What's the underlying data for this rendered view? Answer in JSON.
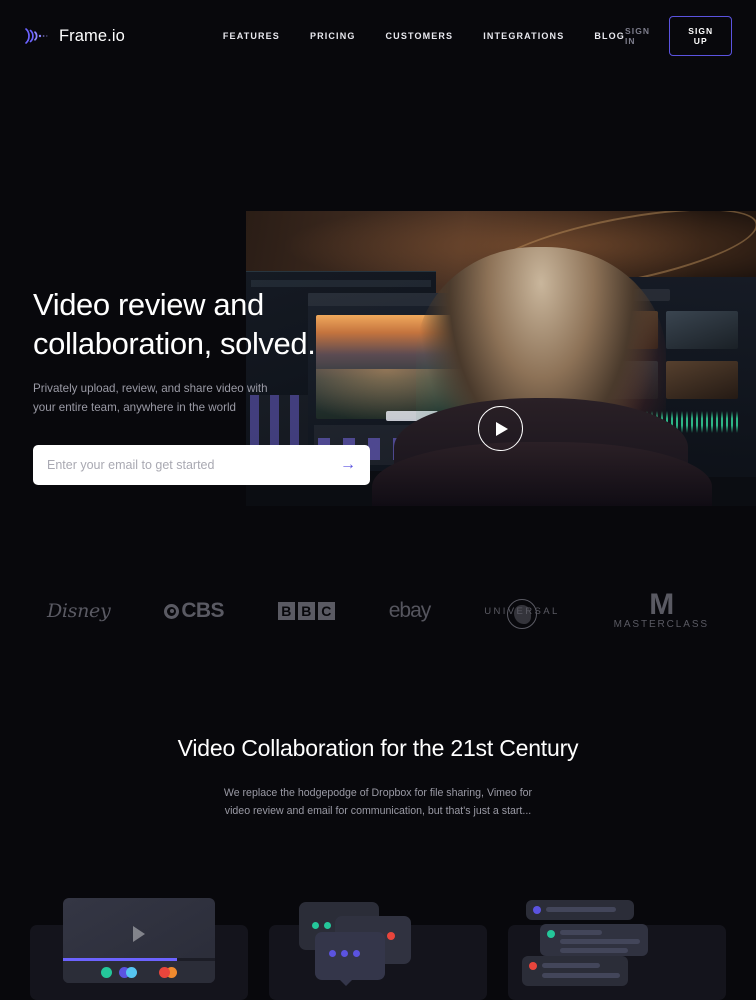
{
  "brand": {
    "name": "Frame.io",
    "logo_icon": "waveform-icon",
    "accent": "#5b53e0"
  },
  "nav": {
    "links": [
      {
        "label": "FEATURES"
      },
      {
        "label": "PRICING"
      },
      {
        "label": "CUSTOMERS"
      },
      {
        "label": "INTEGRATIONS"
      },
      {
        "label": "BLOG"
      }
    ],
    "sign_in": "SIGN IN",
    "sign_up": "SIGN UP"
  },
  "hero": {
    "title": "Video review and\ncollaboration, solved.",
    "subtitle": "Privately upload, review, and share video with\nyour entire team, anywhere in the world",
    "email_placeholder": "Enter your email to get started",
    "email_value": "",
    "submit_icon": "arrow-right-icon",
    "play_icon": "play-icon"
  },
  "logos": [
    {
      "name": "Disney"
    },
    {
      "name": "CBS"
    },
    {
      "name": "BBC"
    },
    {
      "name": "ebay"
    },
    {
      "name": "UNIVERSAL"
    },
    {
      "name": "MASTERCLASS"
    },
    {
      "bbc_letters": [
        "B",
        "B",
        "C"
      ]
    },
    {
      "masterclass_mark": "M"
    }
  ],
  "section": {
    "title": "Video Collaboration for the 21st Century",
    "subtitle": "We replace the hodgepodge of Dropbox for file sharing, Vimeo for\nvideo review and email for communication, but that's just a start..."
  },
  "cards": [
    {
      "art": "video-player-illustration"
    },
    {
      "art": "chat-bubbles-illustration"
    },
    {
      "art": "comment-rows-illustration"
    }
  ]
}
